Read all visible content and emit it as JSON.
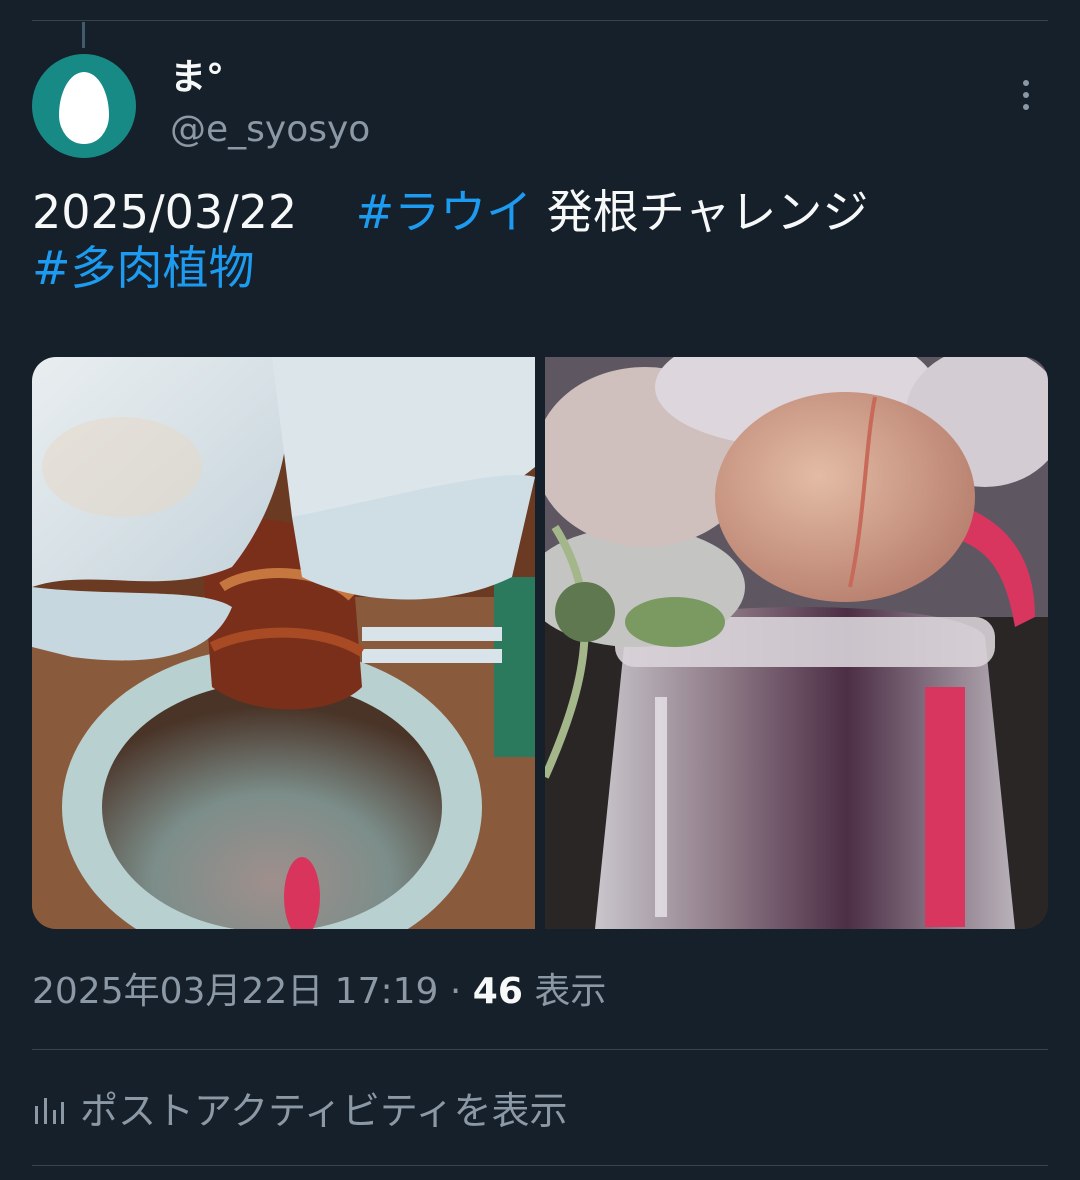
{
  "author": {
    "display_name": "ま°",
    "handle": "@e_syosyo",
    "avatar_icon": "egg-avatar-icon"
  },
  "more_icon": "more-vertical-icon",
  "tweet": {
    "date_text": "2025/03/22",
    "hashtag_1": "#ラウイ",
    "text_after_hashtag": " 発根チャレンジ",
    "hashtag_2": "#多肉植物"
  },
  "media": [
    {
      "alt": "photo-1"
    },
    {
      "alt": "photo-2"
    }
  ],
  "meta": {
    "timestamp": "2025年03月22日 17:19",
    "separator": " · ",
    "views_count": "46",
    "views_label": " 表示"
  },
  "activity": {
    "label": "ポストアクティビティを表示",
    "icon": "analytics-icon"
  },
  "colors": {
    "background": "#15202b",
    "link": "#1d9bf0",
    "secondary_text": "#8b98a5",
    "avatar_bg": "#178a85"
  }
}
